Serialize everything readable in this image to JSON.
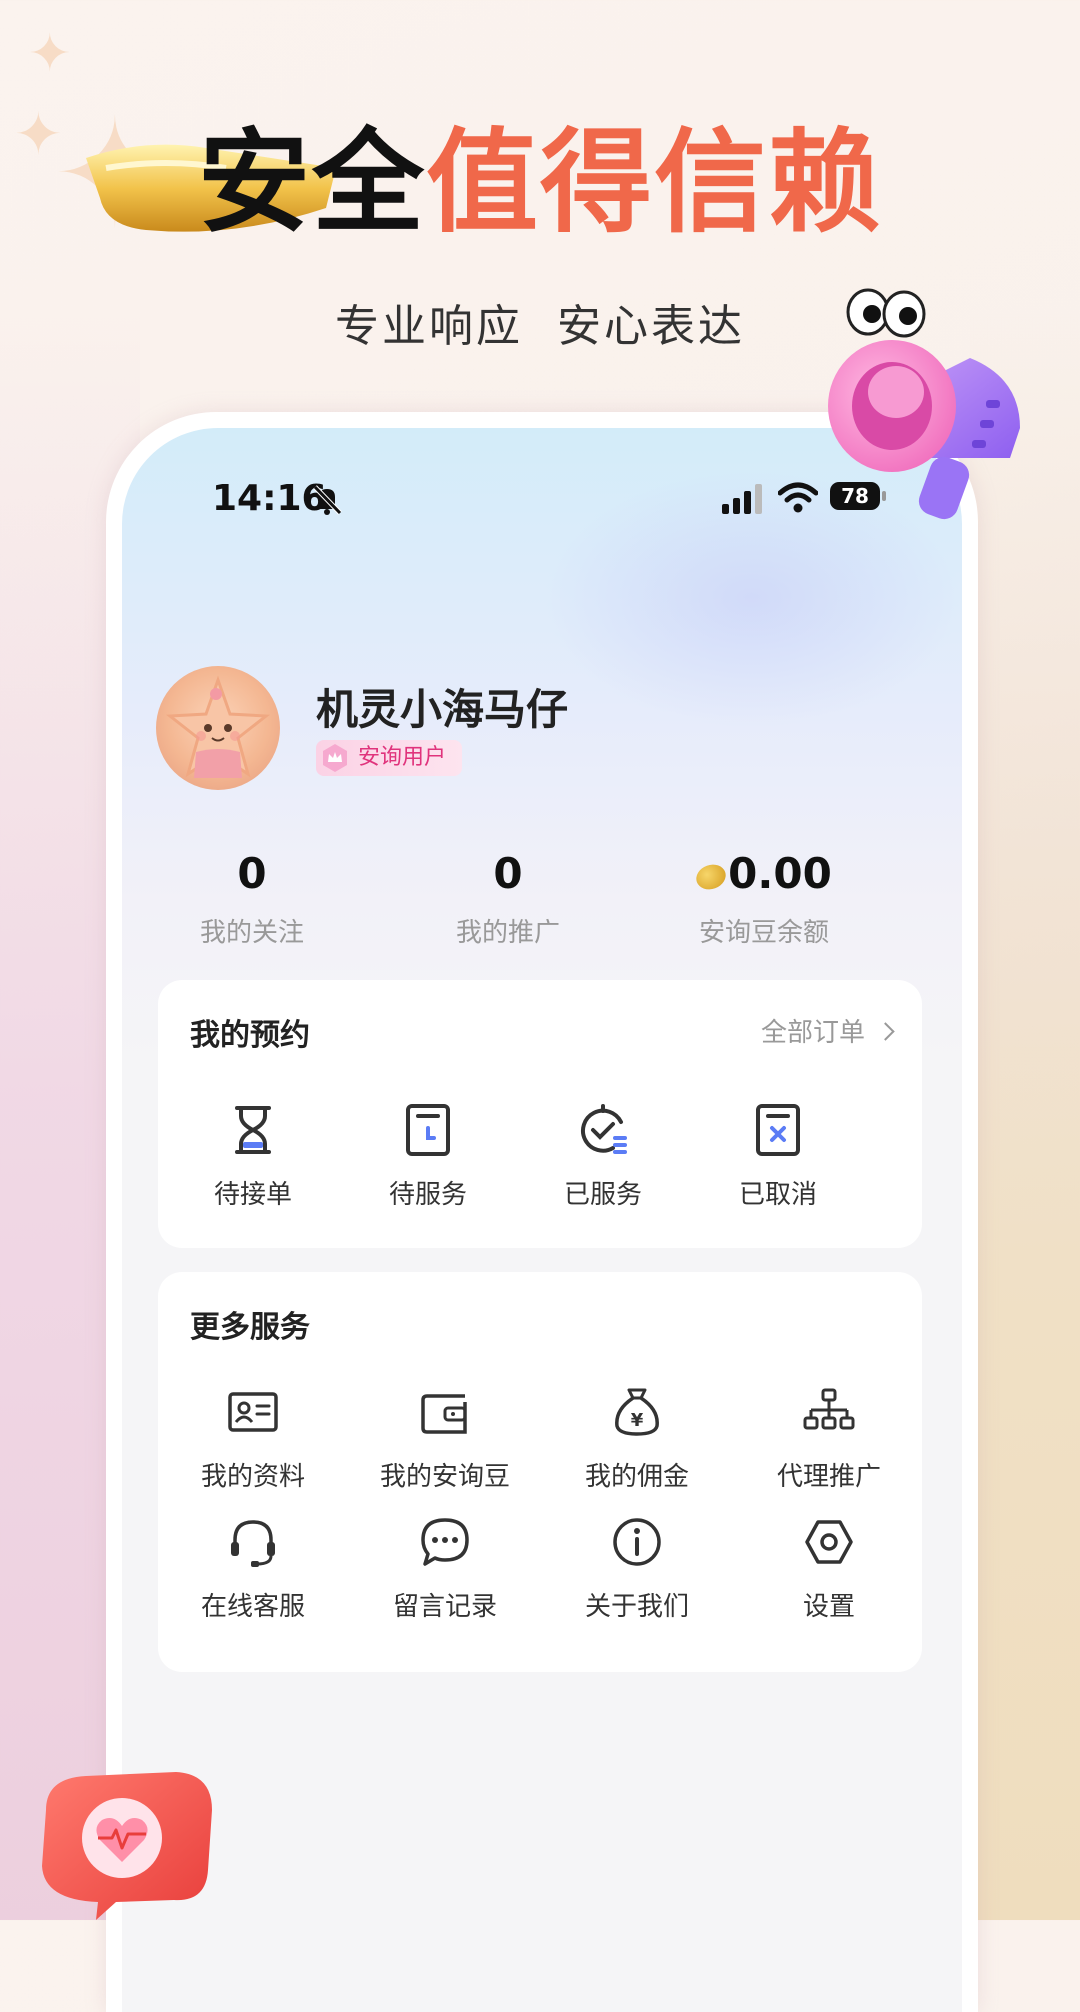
{
  "promo": {
    "headline_black": "安全",
    "headline_orange": "值得信赖",
    "subline": "专业响应  安心表达"
  },
  "status_bar": {
    "time": "14:16",
    "battery": "78"
  },
  "profile": {
    "username": "机灵小海马仔",
    "badge": "安询用户"
  },
  "stats": [
    {
      "value": "0",
      "label": "我的关注"
    },
    {
      "value": "0",
      "label": "我的推广"
    },
    {
      "value": "0.00",
      "label": "安询豆余额"
    }
  ],
  "appointments": {
    "title": "我的预约",
    "all_orders": "全部订单",
    "items": [
      {
        "label": "待接单",
        "icon": "hourglass-icon"
      },
      {
        "label": "待服务",
        "icon": "pending-clipboard-icon"
      },
      {
        "label": "已服务",
        "icon": "served-check-icon"
      },
      {
        "label": "已取消",
        "icon": "cancelled-clipboard-icon"
      }
    ]
  },
  "more_services": {
    "title": "更多服务",
    "items": [
      {
        "label": "我的资料",
        "icon": "id-card-icon"
      },
      {
        "label": "我的安询豆",
        "icon": "wallet-icon"
      },
      {
        "label": "我的佣金",
        "icon": "money-bag-icon"
      },
      {
        "label": "代理推广",
        "icon": "org-chart-icon"
      },
      {
        "label": "在线客服",
        "icon": "headset-icon"
      },
      {
        "label": "留言记录",
        "icon": "chat-bubble-icon"
      },
      {
        "label": "关于我们",
        "icon": "info-icon"
      },
      {
        "label": "设置",
        "icon": "settings-hexagon-icon"
      }
    ]
  },
  "colors": {
    "accent_orange": "#f0684a",
    "badge_pink": "#e0337c",
    "icon_blue": "#5b7cf5"
  }
}
